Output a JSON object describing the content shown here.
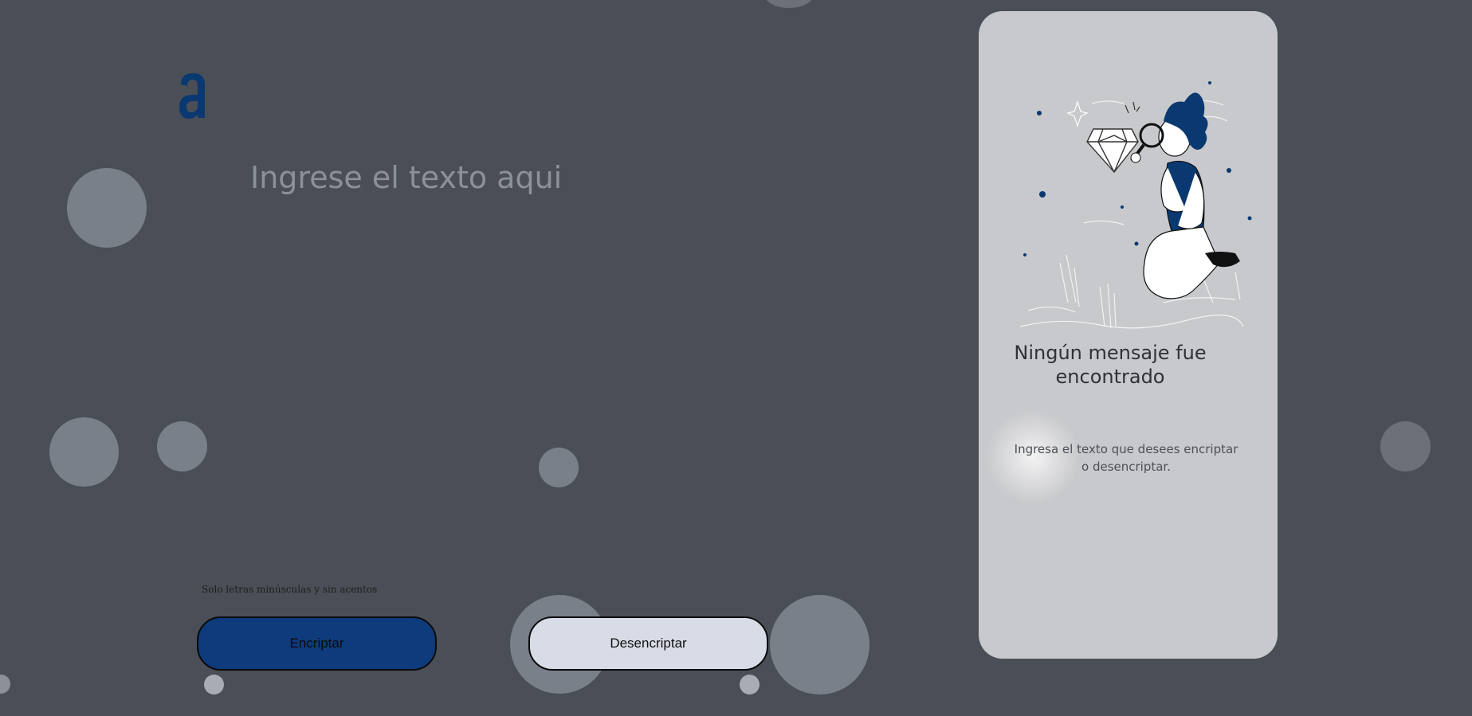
{
  "input": {
    "placeholder": "Ingrese el texto aqui",
    "value": ""
  },
  "hint": "Solo letras minúsculas y sin acentos",
  "buttons": {
    "encrypt": "Encriptar",
    "decrypt": "Desencriptar"
  },
  "output_panel": {
    "title": "Ningún mensaje fue encontrado",
    "text": "Ingresa el texto que desees encriptar o desencriptar.",
    "illustration": "person-with-magnifier-and-diamond"
  },
  "logo": {
    "icon": "alura-a-logo-icon",
    "color": "#0a3871"
  },
  "colors": {
    "background": "#4a4f57",
    "primary": "#0e3b7b",
    "secondary_button": "#d8dce6",
    "panel": "#c8c9cc"
  }
}
